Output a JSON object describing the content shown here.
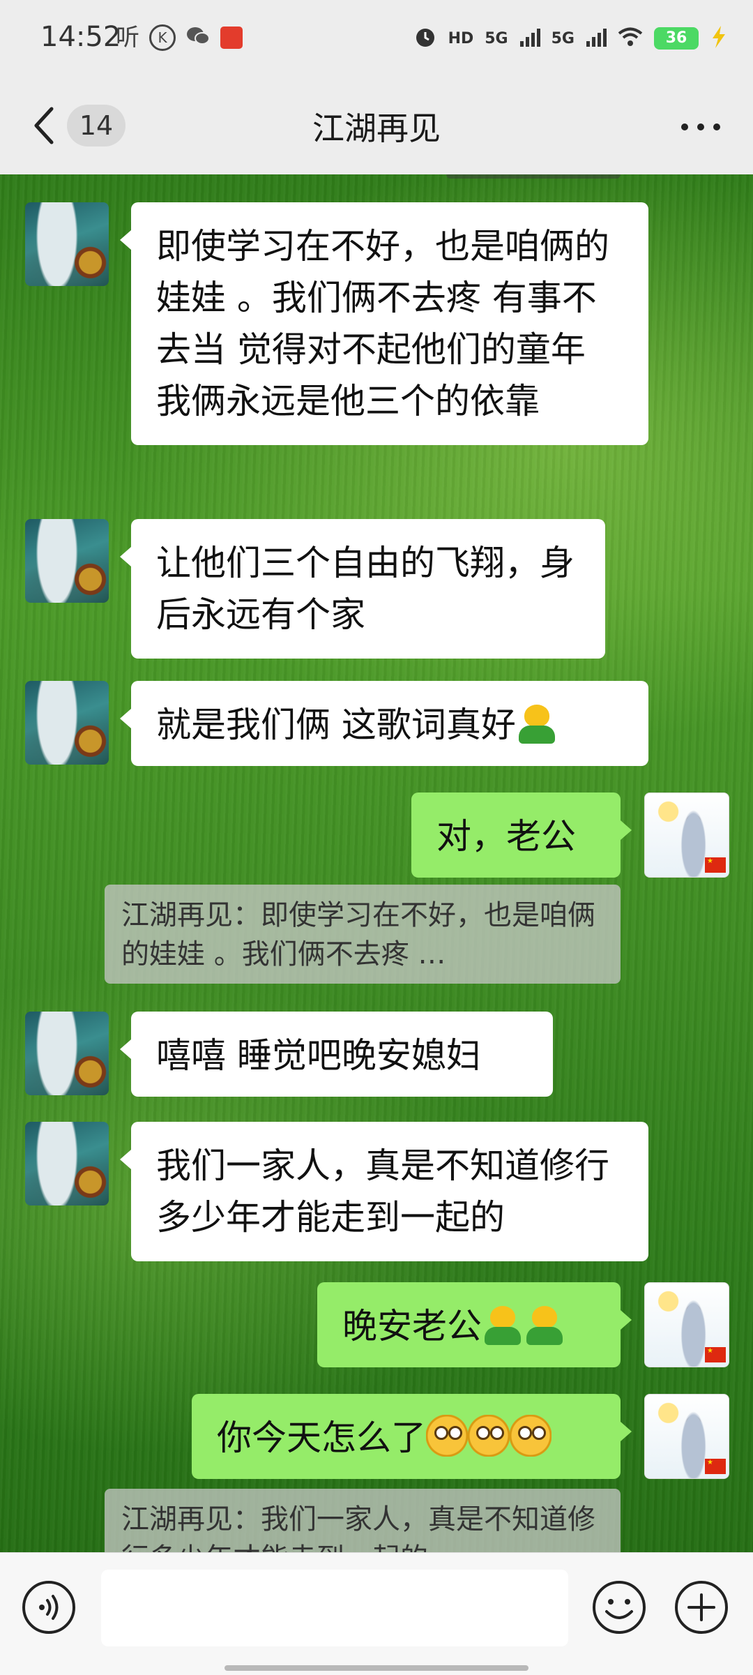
{
  "status_bar": {
    "time": "14:52",
    "listen_glyph": "听",
    "k_glyph": "K",
    "hd_label": "HD",
    "network_1": "5G",
    "network_2": "5G",
    "battery": "36",
    "icons": [
      "alarm-icon",
      "hd-icon",
      "signal-icon",
      "wifi-icon",
      "charging-icon",
      "wechat-icon",
      "app-icon"
    ]
  },
  "nav": {
    "unread_count": "14",
    "title": "江湖再见"
  },
  "messages": [
    {
      "side": "other",
      "text": "即使学习在不好，也是咱俩的娃娃 。我们俩不去疼 有事不去当   觉得对不起他们的童年   我俩永远是他三个的依靠"
    },
    {
      "side": "other",
      "text": "让他们三个自由的飞翔，身后永远有个家"
    },
    {
      "side": "other",
      "text": "就是我们俩  这歌词真好",
      "emoji": [
        "shy"
      ]
    },
    {
      "side": "me",
      "text": "对，老公"
    },
    {
      "side": "quote",
      "text": "江湖再见：即使学习在不好，也是咱俩的娃娃 。我们俩不去疼 …"
    },
    {
      "side": "other",
      "text": "嘻嘻 睡觉吧晚安媳妇"
    },
    {
      "side": "other",
      "text": "我们一家人，真是不知道修行多少年才能走到一起的"
    },
    {
      "side": "me",
      "text": "晚安老公",
      "emoji": [
        "shy",
        "shy"
      ]
    },
    {
      "side": "me",
      "text": "你今天怎么了",
      "emoji": [
        "dizzy",
        "dizzy",
        "dizzy"
      ]
    },
    {
      "side": "quote",
      "text": "江湖再见：我们一家人，真是不知道修行多少年才能走到一起的"
    }
  ],
  "input": {
    "value": "",
    "placeholder": ""
  },
  "colors": {
    "my_bubble": "#95ec69",
    "other_bubble": "#ffffff",
    "bar_bg": "#ededed"
  }
}
